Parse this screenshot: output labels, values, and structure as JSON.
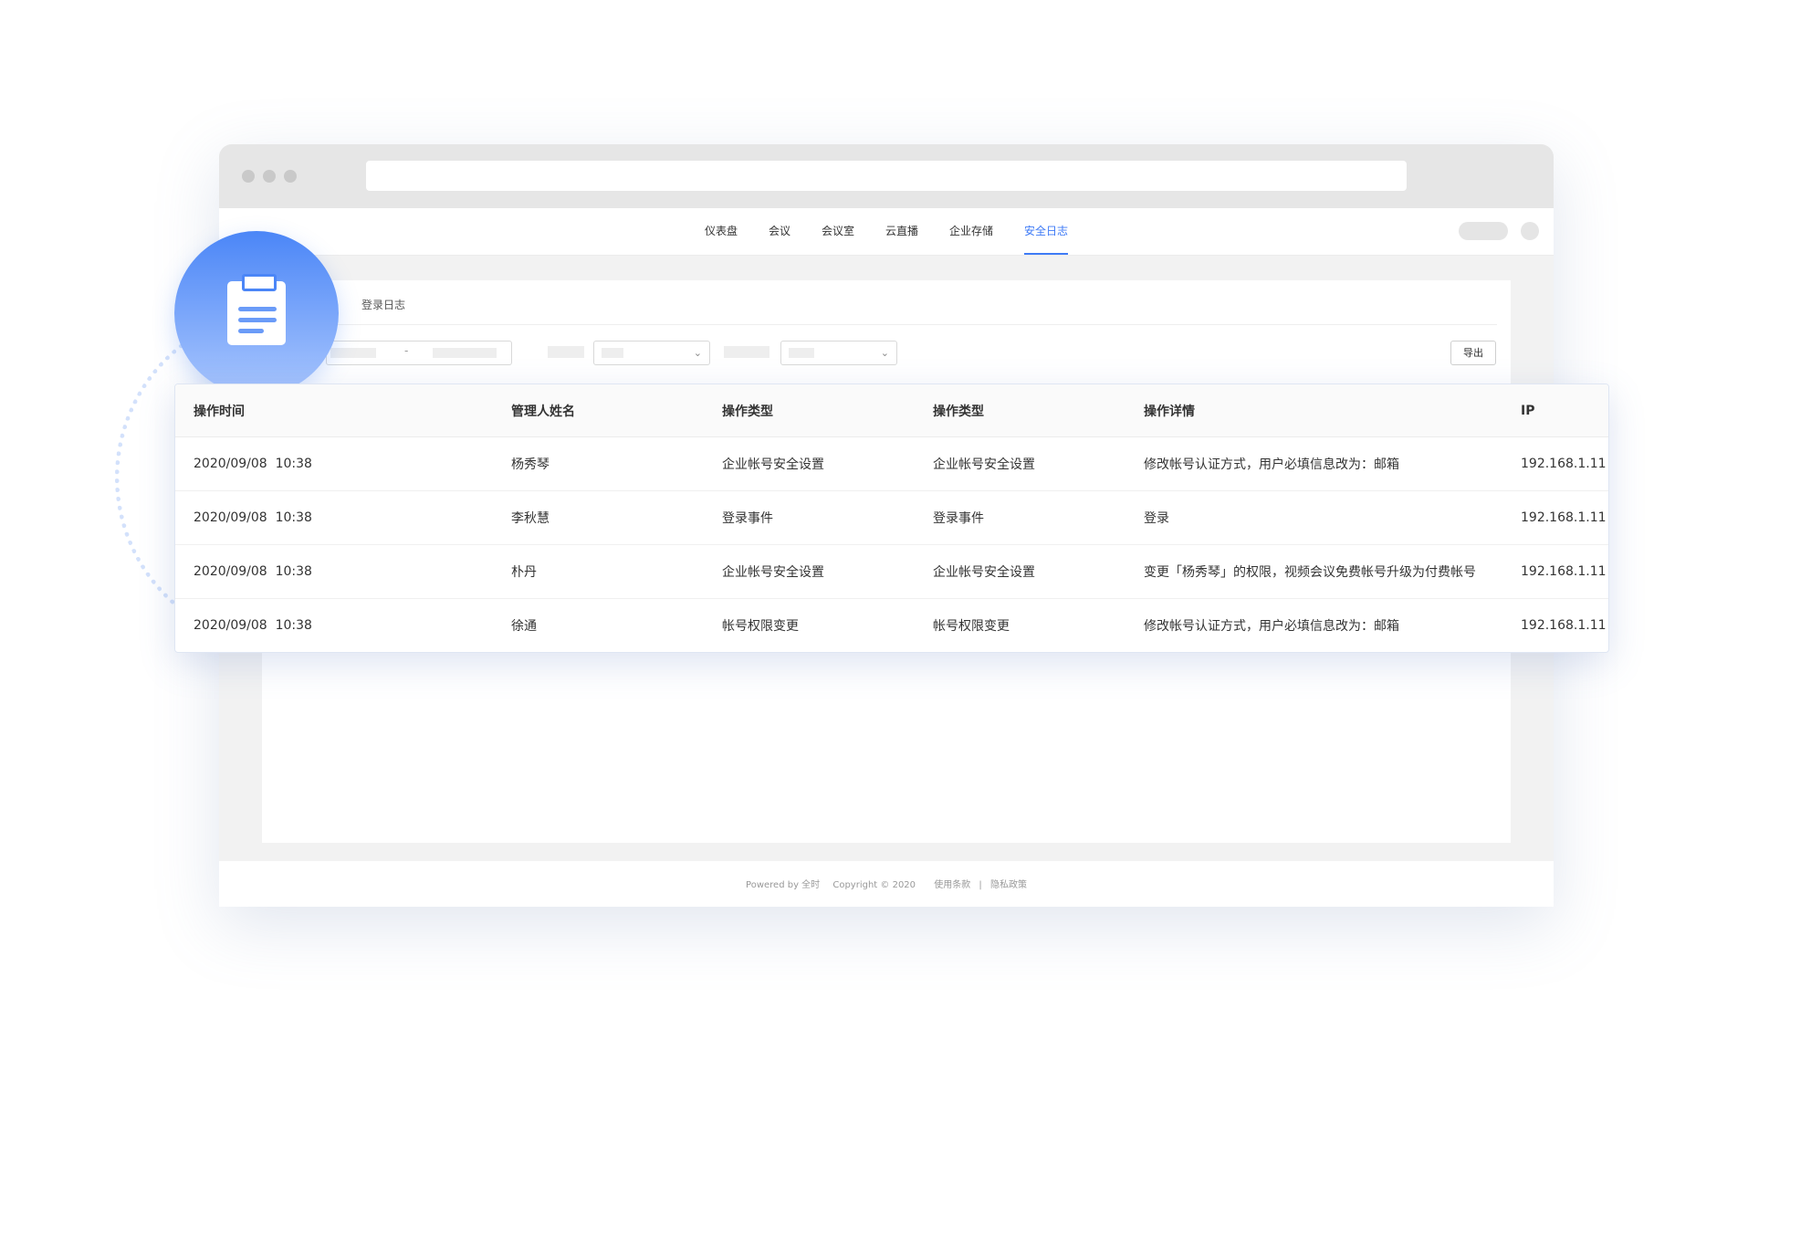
{
  "nav": {
    "items": [
      "仪表盘",
      "会议",
      "会议室",
      "云直播",
      "企业存储",
      "安全日志"
    ],
    "active_index": 5
  },
  "subtab": {
    "label": "登录日志"
  },
  "filters": {
    "date_separator": "-",
    "export_label": "导出"
  },
  "table": {
    "headers": [
      "操作时间",
      "管理人姓名",
      "操作类型",
      "操作类型",
      "操作详情",
      "IP"
    ],
    "rows": [
      [
        "2020/09/08  10:38",
        "杨秀琴",
        "企业帐号安全设置",
        "企业帐号安全设置",
        "修改帐号认证方式，用户必填信息改为：邮箱",
        "192.168.1.11"
      ],
      [
        "2020/09/08  10:38",
        "李秋慧",
        "登录事件",
        "登录事件",
        "登录",
        "192.168.1.11"
      ],
      [
        "2020/09/08  10:38",
        "朴丹",
        "企业帐号安全设置",
        "企业帐号安全设置",
        "变更「杨秀琴」的权限，视频会议免费帐号升级为付费帐号",
        "192.168.1.11"
      ],
      [
        "2020/09/08  10:38",
        "徐通",
        "帐号权限变更",
        "帐号权限变更",
        "修改帐号认证方式，用户必填信息改为：邮箱",
        "192.168.1.11"
      ]
    ]
  },
  "footer": {
    "powered": "Powered by 全时",
    "copyright": "Copyright © 2020",
    "terms": "使用条款",
    "divider": "|",
    "privacy": "隐私政策"
  },
  "colors": {
    "accent": "#3f7bf6",
    "badge_top": "#4b86f7",
    "badge_bottom": "#a9c6fd"
  },
  "icons": {
    "badge": "clipboard-icon"
  }
}
